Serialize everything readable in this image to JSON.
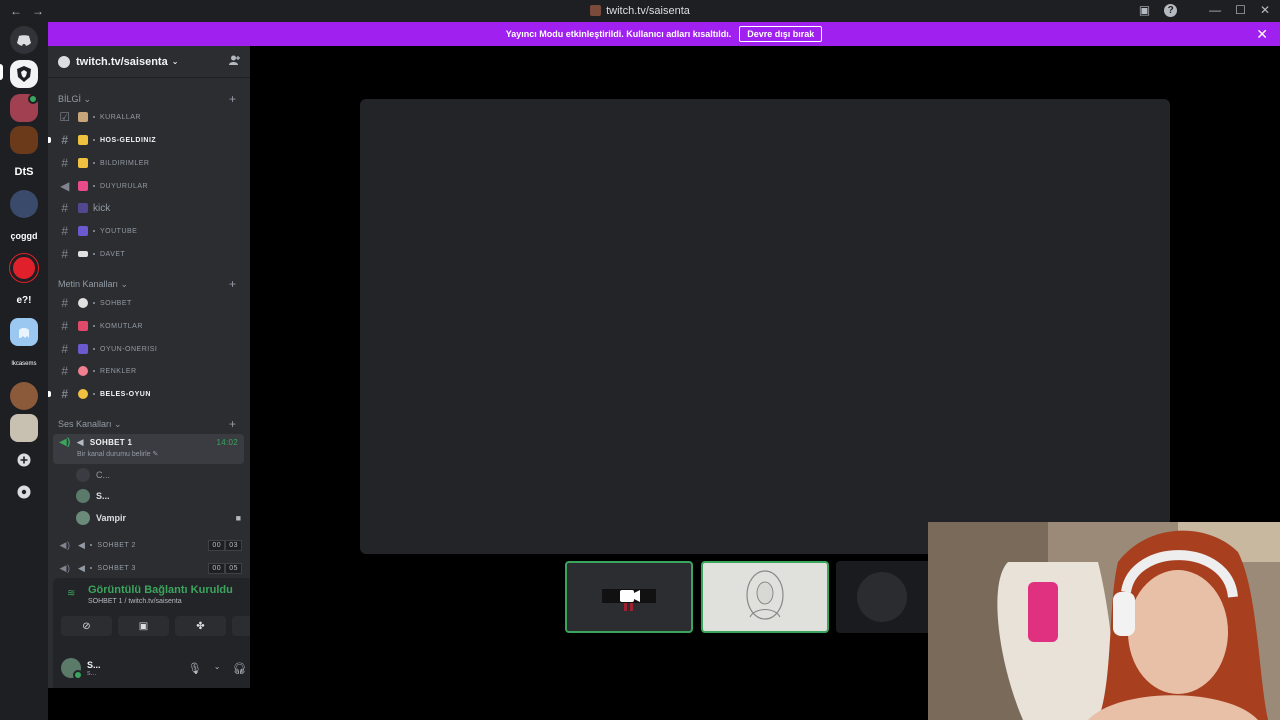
{
  "window": {
    "url": "twitch.tv/saisenta",
    "nav_back": "←",
    "nav_forward": "→",
    "controls": {
      "minimize": "—",
      "maximize": "☐",
      "close": "✕",
      "inbox": "▣",
      "help": "?"
    }
  },
  "banner": {
    "text": "Yayıncı Modu etkinleştirildi. Kullanıcı adları kısaltıldı.",
    "button": "Devre dışı bırak",
    "close": "✕"
  },
  "rail": {
    "servers": [
      {
        "label": "DtS"
      },
      {
        "label": "çoggd"
      },
      {
        "label": "e?!"
      },
      {
        "label": "lkcasems"
      }
    ]
  },
  "sidebar": {
    "server_name": "twitch.tv/saisenta",
    "categories": {
      "info": "BİLGİ",
      "text": "Metin Kanalları",
      "voice": "Ses Kanalları"
    },
    "info_channels": [
      {
        "name": "KURALLAR",
        "emoji_color": "#c9a67a"
      },
      {
        "name": "HOS-GELDINIZ",
        "emoji_color": "#f0c040"
      },
      {
        "name": "BILDIRIMLER",
        "emoji_color": "#f0c040"
      },
      {
        "name": "DUYURULAR",
        "emoji_color": "#e84a8a"
      },
      {
        "name": "kick",
        "emoji_color": "#6a5ad0"
      },
      {
        "name": "YOUTUBE",
        "emoji_color": "#6a5ad0"
      },
      {
        "name": "DAVET",
        "emoji_color": "#e0e0e0"
      }
    ],
    "text_channels": [
      {
        "name": "SOHBET",
        "emoji_color": "#e0e0e0"
      },
      {
        "name": "KOMUTLAR",
        "emoji_color": "#e04a6a"
      },
      {
        "name": "OYUN-ONERISI",
        "emoji_color": "#6a5ad0"
      },
      {
        "name": "RENKLER",
        "emoji_color": "#f08090"
      },
      {
        "name": "BELES-OYUN",
        "emoji_color": "#f0c040"
      }
    ],
    "voice_active": {
      "name": "SOHBET 1",
      "time": "14:02",
      "status": "Bir kanal durumu belirle"
    },
    "voice_users": [
      {
        "name": "C...",
        "avatar_color": "#3a3c42"
      },
      {
        "name": "S...",
        "avatar_color": "#5b7a6a"
      },
      {
        "name": "Vampir",
        "avatar_color": "#6a8a7a",
        "camera": "■"
      }
    ],
    "voice_channels": [
      {
        "name": "SOHBET 2",
        "count_a": "00",
        "count_b": "03"
      },
      {
        "name": "SOHBET 3",
        "count_a": "00",
        "count_b": "05"
      }
    ]
  },
  "voice_panel": {
    "connection": "Görüntülü Bağlantı Kuruldu",
    "channel": "SOHBET 1 / twitch.tv/saisenta",
    "user_name": "S...",
    "user_tag": "s..."
  },
  "colors": {
    "accent_purple": "#a020f0",
    "speaking_green": "#3ba55d"
  }
}
